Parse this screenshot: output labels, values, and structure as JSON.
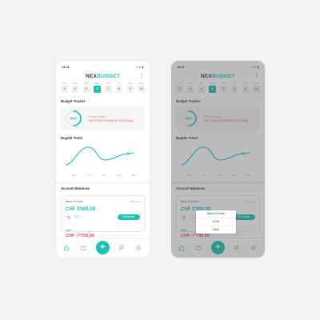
{
  "status": {
    "time": "13:41",
    "icons": "▪ ▾ ▮"
  },
  "logo": {
    "part1": "NEX",
    "part2": "BUDGET"
  },
  "calendar": {
    "days": [
      "Sun",
      "Mon",
      "Tue",
      "Wed",
      "Thu",
      "Fri",
      "Sat",
      "Sun",
      "Mon",
      "Tue"
    ],
    "dates": [
      "3",
      "4",
      "5",
      "6",
      "7",
      "8",
      "9",
      "10"
    ],
    "selected": "6"
  },
  "tracker": {
    "title": "Budget Tracker",
    "percent": "50%",
    "percent_value": 0.5,
    "label": "Flexible Budget",
    "value": "CHF 2'400.00 left(CHF 92,31/Day)"
  },
  "trend": {
    "title": "Bugdet Trend",
    "months": [
      "May",
      "Jun",
      "Jul",
      "Aug",
      "Sep"
    ]
  },
  "accounts": {
    "title": "Account Balances",
    "bank": {
      "name": "Bank of Earth",
      "date": "3 day ago",
      "amount": "CHF 3'000,00",
      "badge": "0",
      "reconcile": "Reconcile"
    },
    "visa": {
      "name": "Visa",
      "amount": "CHF -7'700,00"
    }
  },
  "dropdown": {
    "items": [
      "Bank of Earth",
      "VISA",
      "Cash"
    ]
  },
  "nav": {
    "add": "+"
  },
  "colors": {
    "accent": "#19c3b4",
    "negative": "#e84a5f"
  }
}
